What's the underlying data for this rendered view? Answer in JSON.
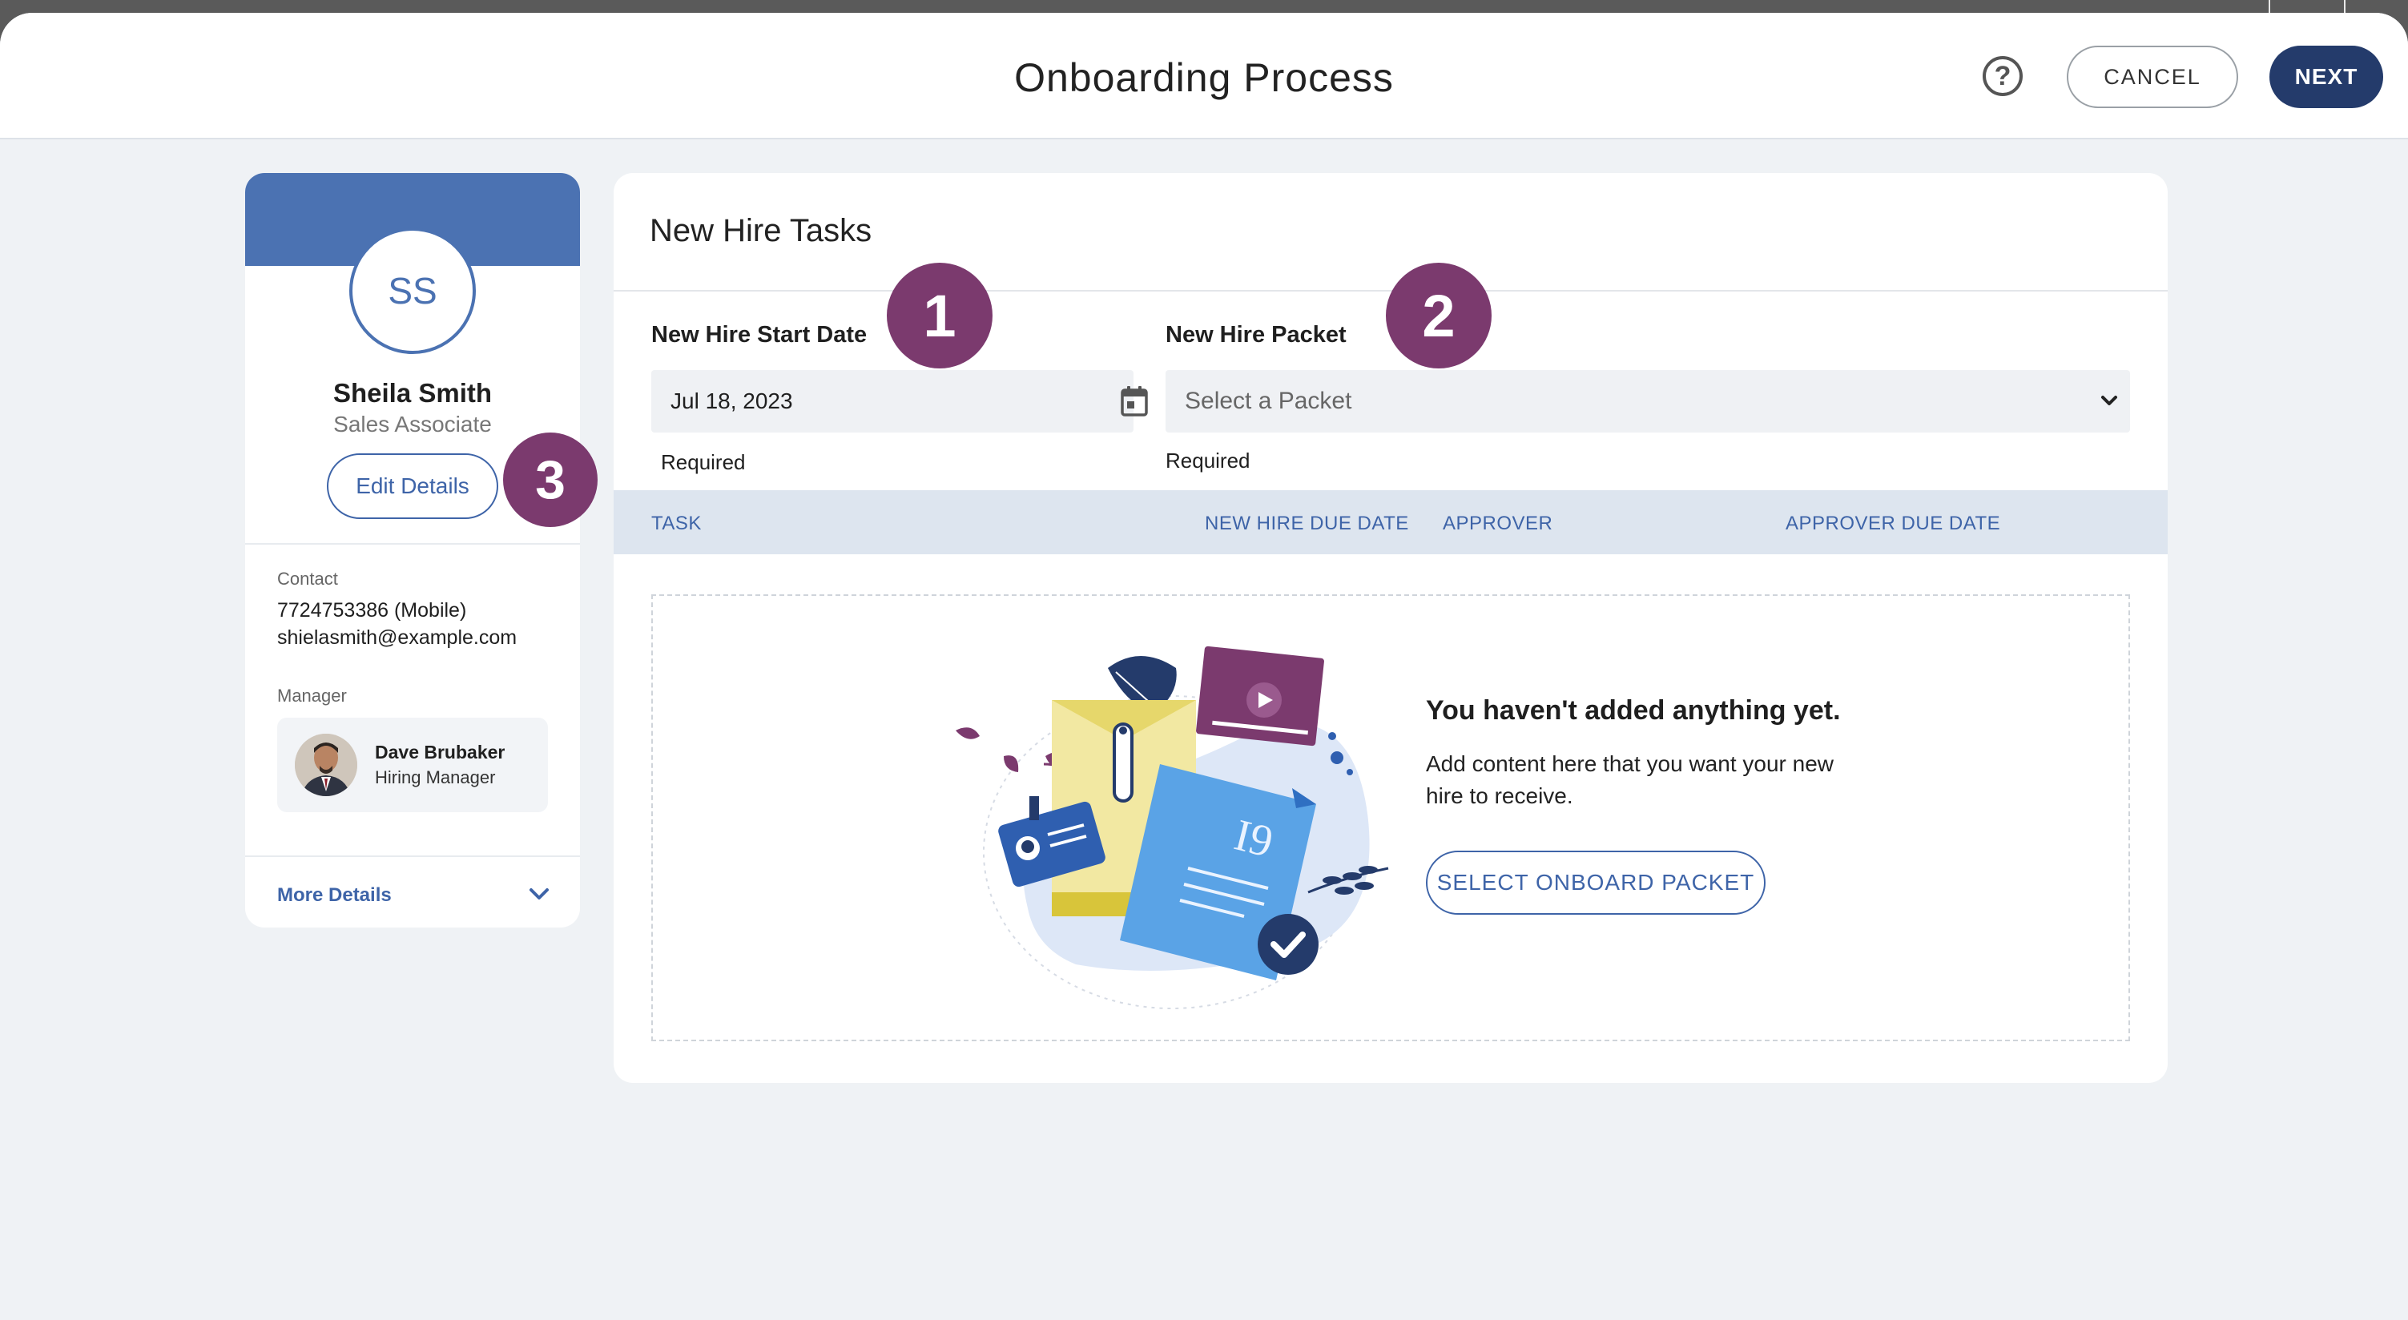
{
  "header": {
    "title": "Onboarding Process",
    "help_icon": "question-circle-icon",
    "help_glyph": "?",
    "cancel_label": "CANCEL",
    "next_label": "NEXT"
  },
  "profile": {
    "initials": "SS",
    "name": "Sheila Smith",
    "role": "Sales Associate",
    "edit_label": "Edit Details",
    "contact_label": "Contact",
    "phone": "7724753386 (Mobile)",
    "email": "shielasmith@example.com",
    "manager_label": "Manager",
    "manager_name": "Dave Brubaker",
    "manager_role": "Hiring Manager",
    "more_details_label": "More Details"
  },
  "tasks": {
    "title": "New Hire Tasks",
    "start_date_label": "New Hire Start Date",
    "start_date_value": "Jul 18, 2023",
    "start_date_required": "Required",
    "packet_label": "New Hire Packet",
    "packet_placeholder": "Select a Packet",
    "packet_required": "Required",
    "columns": [
      "TASK",
      "NEW HIRE DUE DATE",
      "APPROVER",
      "APPROVER DUE DATE"
    ],
    "empty_heading": "You haven't added anything yet.",
    "empty_text": "Add content here that you want your new hire to receive.",
    "empty_button": "SELECT ONBOARD PACKET",
    "illustration_label": "I9"
  },
  "steps": [
    "1",
    "2",
    "3"
  ],
  "colors": {
    "brand_dark": "#243b6b",
    "brand_blue": "#4b72b2",
    "link_blue": "#3e64a8",
    "step_badge": "#7b3a6e",
    "page_bg": "#eff2f5"
  }
}
